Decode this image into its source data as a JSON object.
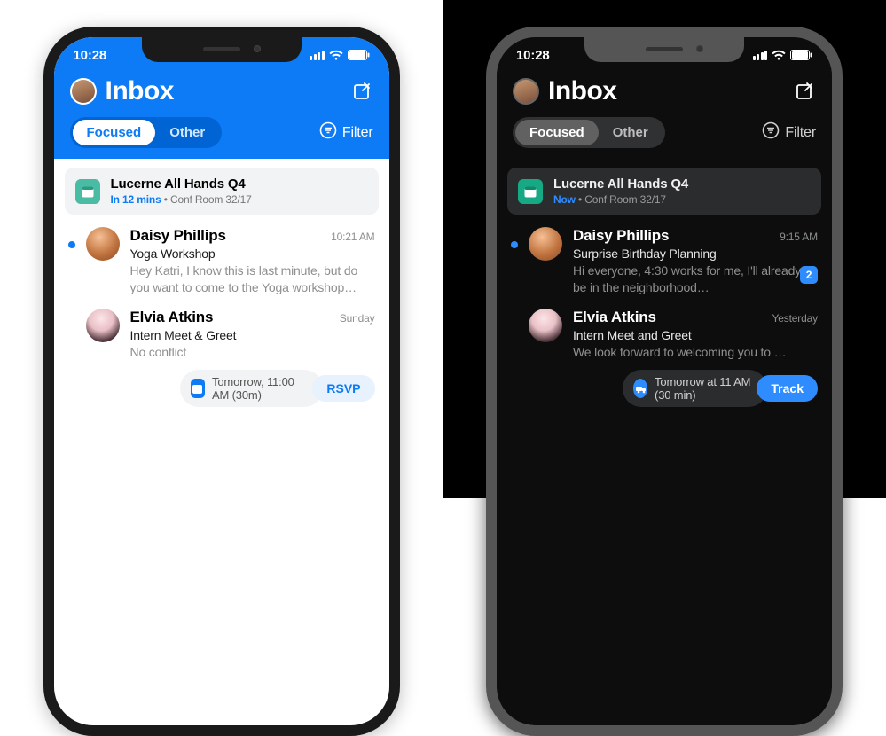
{
  "light": {
    "status_time": "10:28",
    "title": "Inbox",
    "tab_focused": "Focused",
    "tab_other": "Other",
    "filter_label": "Filter",
    "event": {
      "title": "Lucerne All Hands Q4",
      "when": "In 12 mins",
      "where": "Conf Room 32/17",
      "sep": " • "
    },
    "msg1": {
      "sender": "Daisy Phillips",
      "time": "10:21 AM",
      "subject": "Yoga Workshop",
      "preview": "Hey Katri, I know this is last minute, but do you want to come to the Yoga workshop…"
    },
    "msg2": {
      "sender": "Elvia Atkins",
      "time": "Sunday",
      "subject": "Intern Meet & Greet",
      "preview": "No conflict",
      "pill_text": "Tomorrow, 11:00 AM (30m)",
      "action": "RSVP"
    }
  },
  "dark": {
    "status_time": "10:28",
    "title": "Inbox",
    "tab_focused": "Focused",
    "tab_other": "Other",
    "filter_label": "Filter",
    "event": {
      "title": "Lucerne All Hands Q4",
      "when": "Now",
      "where": "Conf Room 32/17",
      "sep": " • "
    },
    "msg1": {
      "sender": "Daisy Phillips",
      "time": "9:15 AM",
      "subject": "Surprise Birthday Planning",
      "preview": "Hi everyone, 4:30 works for me, I'll already be in the neighborhood…",
      "badge": "2"
    },
    "msg2": {
      "sender": "Elvia Atkins",
      "time": "Yesterday",
      "subject": "Intern Meet and Greet",
      "preview": "We look forward to welcoming you to …",
      "pill_text": "Tomorrow at 11 AM (30 min)",
      "action": "Track"
    }
  }
}
